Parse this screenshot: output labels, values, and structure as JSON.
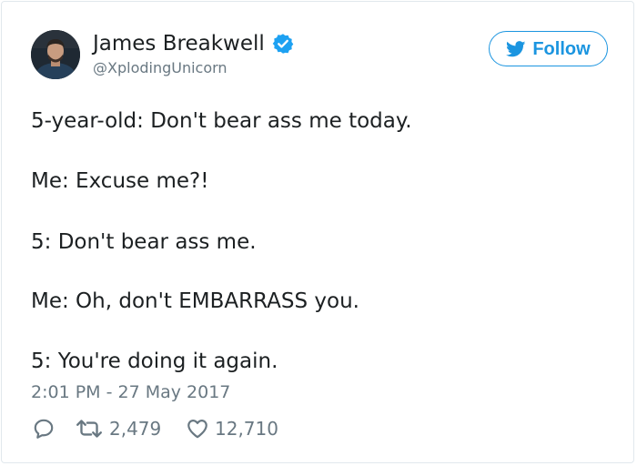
{
  "author": {
    "display_name": "James Breakwell",
    "handle": "@XplodingUnicorn",
    "verified": true,
    "avatar": "profile-photo"
  },
  "follow_button": {
    "label": "Follow",
    "icon": "twitter-bird-icon"
  },
  "tweet": {
    "lines": [
      "5-year-old: Don't bear ass me today.",
      "Me: Excuse me?!",
      "5: Don't bear ass me.",
      "Me: Oh, don't EMBARRASS you.",
      "5: You're doing it again."
    ],
    "timestamp": "2:01 PM - 27 May 2017"
  },
  "actions": {
    "reply": {
      "icon": "reply-icon"
    },
    "retweet": {
      "icon": "retweet-icon",
      "count": "2,479"
    },
    "like": {
      "icon": "heart-icon",
      "count": "12,710"
    }
  },
  "colors": {
    "accent": "#1b95e0",
    "verified": "#1da1f2",
    "text": "#1c2022",
    "muted": "#697882",
    "border": "#e1e8ed"
  }
}
